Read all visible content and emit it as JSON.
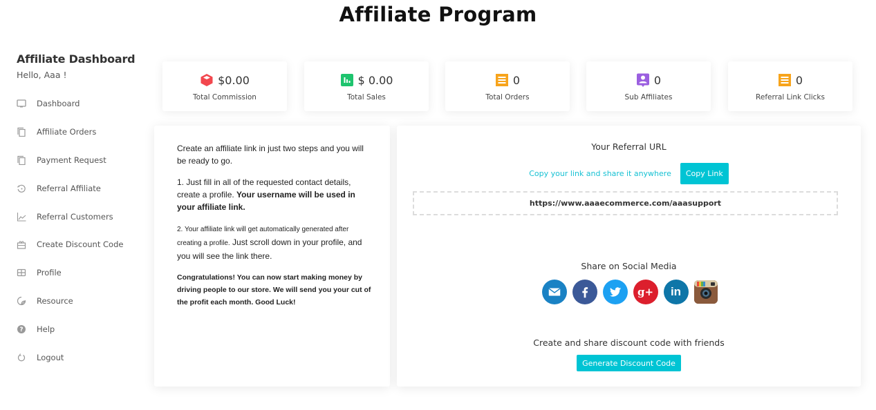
{
  "page": {
    "title": "Affiliate Program"
  },
  "sidebar": {
    "title": "Affiliate Dashboard",
    "greeting": "Hello, Aaa !",
    "items": [
      {
        "label": "Dashboard",
        "icon": "monitor-icon"
      },
      {
        "label": "Affiliate Orders",
        "icon": "copy-icon"
      },
      {
        "label": "Payment Request",
        "icon": "copy-icon"
      },
      {
        "label": "Referral Affiliate",
        "icon": "history-icon"
      },
      {
        "label": "Referral Customers",
        "icon": "line-chart-icon"
      },
      {
        "label": "Create Discount Code",
        "icon": "gift-icon"
      },
      {
        "label": "Profile",
        "icon": "table-icon"
      },
      {
        "label": "Resource",
        "icon": "sticker-icon"
      },
      {
        "label": "Help",
        "icon": "help-circle-icon"
      },
      {
        "label": "Logout",
        "icon": "power-icon"
      }
    ]
  },
  "stats": [
    {
      "value": "$0.00",
      "label": "Total Commission",
      "icon": "cube-icon",
      "color": "#f2474e"
    },
    {
      "value": "$ 0.00",
      "label": "Total Sales",
      "icon": "bar-chart-icon",
      "color": "#1ec46e"
    },
    {
      "value": "0",
      "label": "Total Orders",
      "icon": "receipt-icon",
      "color": "#f7a41c"
    },
    {
      "value": "0",
      "label": "Sub Affiliates",
      "icon": "user-badge-icon",
      "color": "#9b5fe0"
    },
    {
      "value": "0",
      "label": "Referral Link Clicks",
      "icon": "receipt-icon",
      "color": "#f7a41c"
    }
  ],
  "instructions": {
    "intro": "Create an affiliate link in just two steps and you will be ready to go.",
    "step1_plain": "1. Just fill in all of the requested contact details, create a profile. ",
    "step1_bold": "Your username will be used in your affiliate link.",
    "step2_small": "2. Your affiliate link will get automatically generated after creating a profile.",
    "step2_plain": " Just scroll down in your profile, and you will see the link there.",
    "congrats": "Congratulations! You can now start making money by driving people to our store. We will send you your cut of the profit each month. Good Luck!"
  },
  "referral": {
    "title": "Your Referral URL",
    "copy_hint": "Copy your link and share it anywhere",
    "copy_button": "Copy Link",
    "url": "https://www.aaaecommerce.com/aaasupport"
  },
  "social": {
    "title": "Share on Social Media",
    "networks": [
      {
        "name": "email",
        "color": "#1a82c4"
      },
      {
        "name": "facebook",
        "color": "#3b5998"
      },
      {
        "name": "twitter",
        "color": "#1da1f2"
      },
      {
        "name": "google-plus",
        "color": "#dc1f2d"
      },
      {
        "name": "linkedin",
        "color": "#0e76a8"
      },
      {
        "name": "instagram",
        "color": "#8a5a3c"
      }
    ]
  },
  "discount": {
    "title": "Create and share discount code with friends",
    "button": "Generate Discount Code"
  },
  "colors": {
    "accent": "#00c4d4",
    "accent_text": "#17c1d3"
  }
}
